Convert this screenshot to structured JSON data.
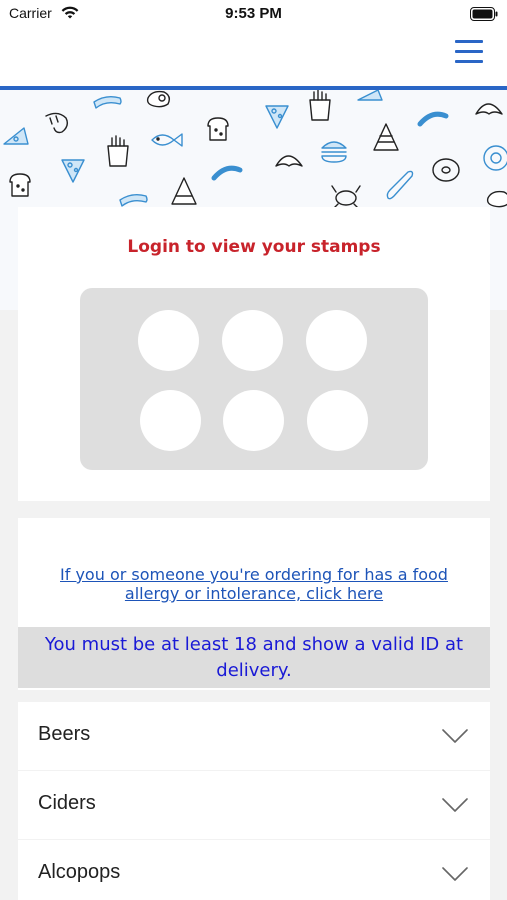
{
  "status_bar": {
    "carrier": "Carrier",
    "time": "9:53 PM",
    "wifi_icon": "wifi-icon",
    "battery_icon": "battery-icon"
  },
  "header": {
    "menu_icon": "hamburger-menu-icon",
    "accent_color": "#2a66c6"
  },
  "banner": {
    "pattern_icons": [
      "toast-icon",
      "shrimp-icon",
      "cheese-icon",
      "hotdog-icon",
      "pizza-slice-icon",
      "fries-icon",
      "fish-icon",
      "sausage-icon",
      "croissant-icon",
      "burger-icon",
      "sandwich-icon",
      "donut-icon",
      "crab-icon",
      "baguette-icon",
      "egg-icon"
    ]
  },
  "stamp_card": {
    "title": "Login to view your stamps",
    "title_color": "#c8232b",
    "stamps_total": 6,
    "stamps_collected": 0
  },
  "info": {
    "allergy_link": "If you or someone you're ordering for has a food allergy or intolerance, click here",
    "age_notice": "You must be at least 18 and show a valid ID at delivery.",
    "link_color": "#1d54b8",
    "notice_color": "#1a1ad6"
  },
  "categories": [
    {
      "label": "Beers"
    },
    {
      "label": "Ciders"
    },
    {
      "label": "Alcopops"
    }
  ]
}
